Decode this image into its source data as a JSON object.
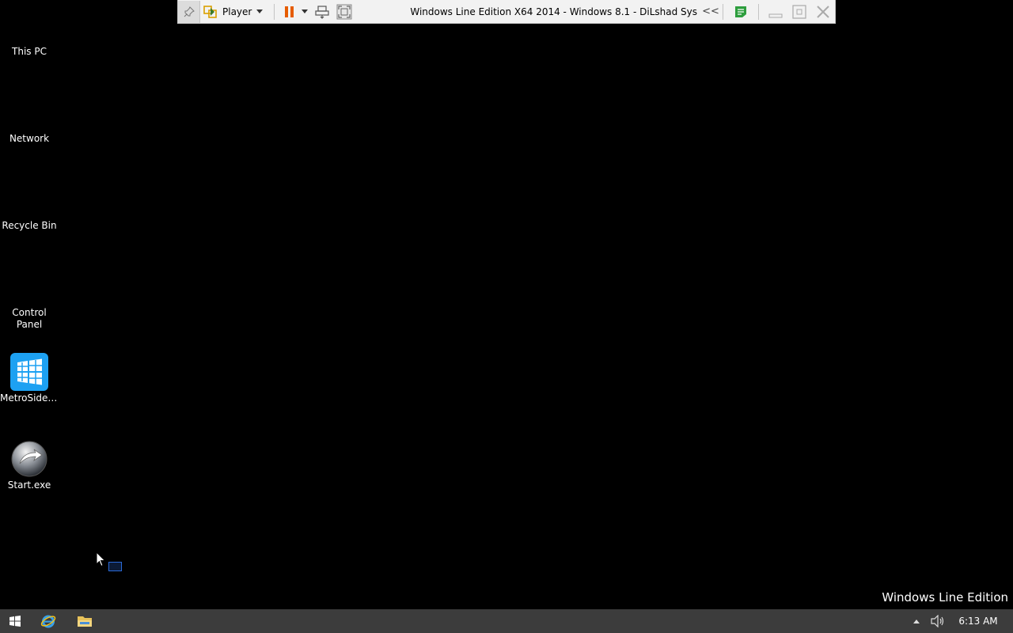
{
  "vm_toolbar": {
    "player_label": "Player",
    "window_title": "Windows Line Edition X64 2014 - Windows 8.1 - DiLshad Sys",
    "collapse_glyph": "<<",
    "icons": [
      "pin-icon",
      "player-icon",
      "pause-icon",
      "send-ctrl-alt-del-icon",
      "full-screen-icon",
      "message-log-icon",
      "minimize-icon",
      "restore-icon",
      "close-icon"
    ]
  },
  "desktop": {
    "icons": [
      {
        "label": "This PC"
      },
      {
        "label": "Network"
      },
      {
        "label": "Recycle Bin"
      },
      {
        "label": "Control Panel"
      },
      {
        "label": "MetroSideb...",
        "icon": "metro-sidebar-icon"
      },
      {
        "label": "Start.exe",
        "icon": "start-exe-icon"
      }
    ],
    "watermark": "Windows Line Edition"
  },
  "taskbar": {
    "apps": [
      "start-button",
      "internet-explorer-icon",
      "file-explorer-icon"
    ],
    "clock": "6:13 AM"
  },
  "colors": {
    "desktop_bg": "#000000",
    "taskbar_bg": "#3c3c3c",
    "toolbar_bg": "#f2f2f2",
    "pause_orange": "#e65c00",
    "metro_blue": "#1da1f2"
  }
}
